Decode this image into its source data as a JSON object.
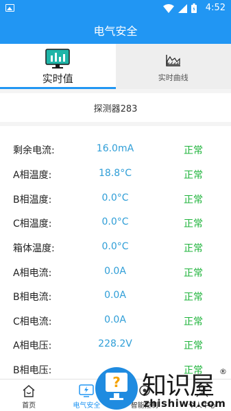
{
  "status_bar": {
    "time": "4:52"
  },
  "app_bar": {
    "title": "电气安全"
  },
  "tabs": [
    {
      "label": "实时值",
      "icon": "monitor-chart-icon",
      "active": true
    },
    {
      "label": "实时曲线",
      "icon": "area-chart-icon",
      "active": false
    }
  ],
  "device": {
    "name": "探测器283"
  },
  "rows": [
    {
      "label": "剩余电流:",
      "value": "16.0mA",
      "status": "正常"
    },
    {
      "label": "A相温度:",
      "value": "18.8°C",
      "status": "正常"
    },
    {
      "label": "B相温度:",
      "value": "0.0°C",
      "status": "正常"
    },
    {
      "label": "C相温度:",
      "value": "0.0°C",
      "status": "正常"
    },
    {
      "label": "箱体温度:",
      "value": "0.0°C",
      "status": "正常"
    },
    {
      "label": "A相电流:",
      "value": "0.0A",
      "status": "正常"
    },
    {
      "label": "B相电流:",
      "value": "0.0A",
      "status": "正常"
    },
    {
      "label": "C相电流:",
      "value": "0.0A",
      "status": "正常"
    },
    {
      "label": "A相电压:",
      "value": "228.2V",
      "status": "正常"
    },
    {
      "label": "B相电压:",
      "value": "",
      "status": "正常"
    }
  ],
  "bottom_nav": [
    {
      "label": "首页",
      "icon": "home-icon",
      "active": false
    },
    {
      "label": "电气安全",
      "icon": "lightning-icon",
      "active": true
    },
    {
      "label": "智能控制",
      "icon": "control-icon",
      "active": false
    },
    {
      "label": "个人中心",
      "icon": "person-icon",
      "active": false
    }
  ],
  "watermark": {
    "brand": "知识屋",
    "domain": "zhishiwu.com",
    "reg": "®"
  },
  "colors": {
    "primary": "#2196f3",
    "value": "#2f9ed7",
    "status_ok": "#1db33a"
  }
}
